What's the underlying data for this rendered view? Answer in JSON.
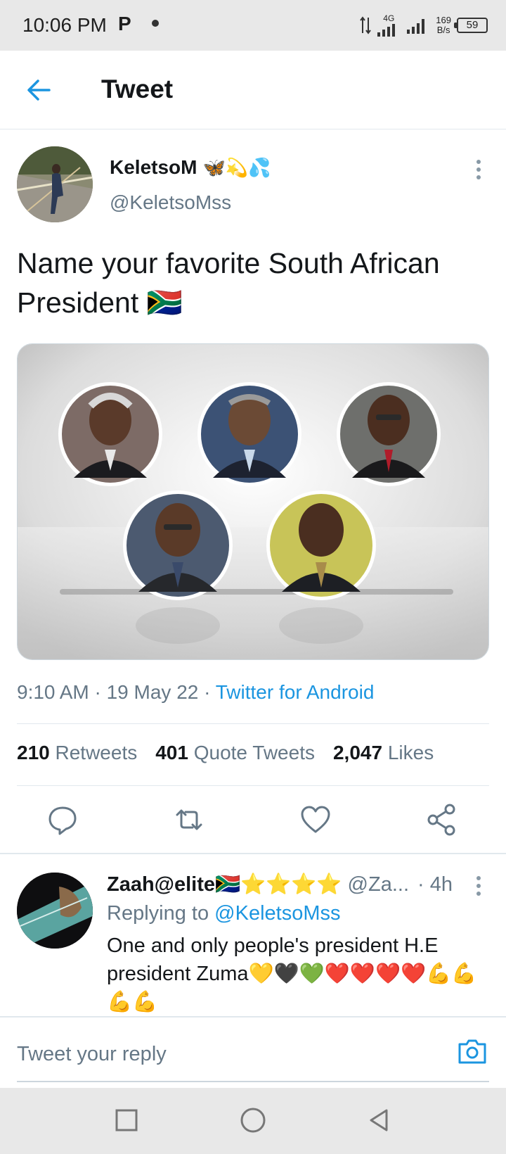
{
  "status_bar": {
    "time": "10:06 PM",
    "app_indicator": "P",
    "network_type": "4G",
    "net_speed_value": "169",
    "net_speed_unit": "B/s",
    "battery": "59"
  },
  "header": {
    "title": "Tweet",
    "back_icon": "arrow-left-icon"
  },
  "tweet": {
    "author_name": "KeletsoM",
    "author_emojis": "🦋💫💦",
    "author_handle": "@KeletsoMss",
    "text": "Name your favorite South African President 🇿🇦",
    "timestamp": "9:10 AM · 19 May 22 · ",
    "source": "Twitter for Android",
    "retweets_count": "210",
    "retweets_label": "Retweets",
    "quotes_count": "401",
    "quotes_label": "Quote Tweets",
    "likes_count": "2,047",
    "likes_label": "Likes"
  },
  "reply": {
    "name": "Zaah@elite🇿🇦⭐⭐⭐⭐",
    "handle": "@Za...",
    "time": "· 4h",
    "replying_prefix": "Replying to ",
    "replying_to": "@KeletsoMss",
    "text": "One and only people's president H.E president Zuma💛🖤💚❤️❤️❤️❤️💪💪💪💪"
  },
  "compose": {
    "placeholder": "Tweet your reply"
  },
  "colors": {
    "accent": "#1b95e0",
    "muted": "#657786",
    "divider": "#e1e8ed"
  }
}
